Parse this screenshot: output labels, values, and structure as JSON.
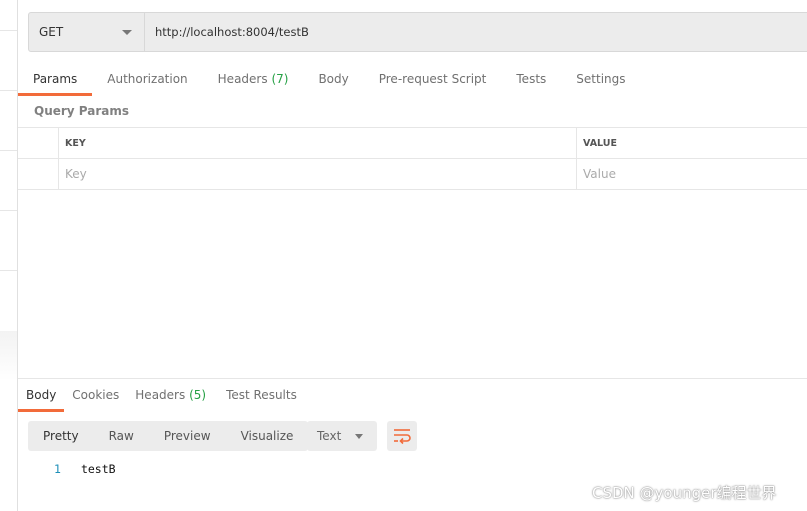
{
  "request": {
    "method": "GET",
    "url": "http://localhost:8004/testB"
  },
  "request_tabs": [
    {
      "label": "Params",
      "active": true
    },
    {
      "label": "Authorization"
    },
    {
      "label": "Headers",
      "count": "(7)"
    },
    {
      "label": "Body"
    },
    {
      "label": "Pre-request Script"
    },
    {
      "label": "Tests"
    },
    {
      "label": "Settings"
    }
  ],
  "query_params": {
    "title": "Query Params",
    "key_header": "KEY",
    "value_header": "VALUE",
    "key_placeholder": "Key",
    "value_placeholder": "Value"
  },
  "response_tabs": [
    {
      "label": "Body",
      "active": true
    },
    {
      "label": "Cookies"
    },
    {
      "label": "Headers",
      "count": "(5)"
    },
    {
      "label": "Test Results"
    }
  ],
  "view_modes": [
    "Pretty",
    "Raw",
    "Preview",
    "Visualize"
  ],
  "format": "Text",
  "body": {
    "line": "1",
    "content": "testB"
  },
  "watermark": "CSDN @younger编程世界",
  "colors": {
    "accent": "#f26b3a",
    "count": "#26a045",
    "line_number": "#1e8fb8"
  }
}
